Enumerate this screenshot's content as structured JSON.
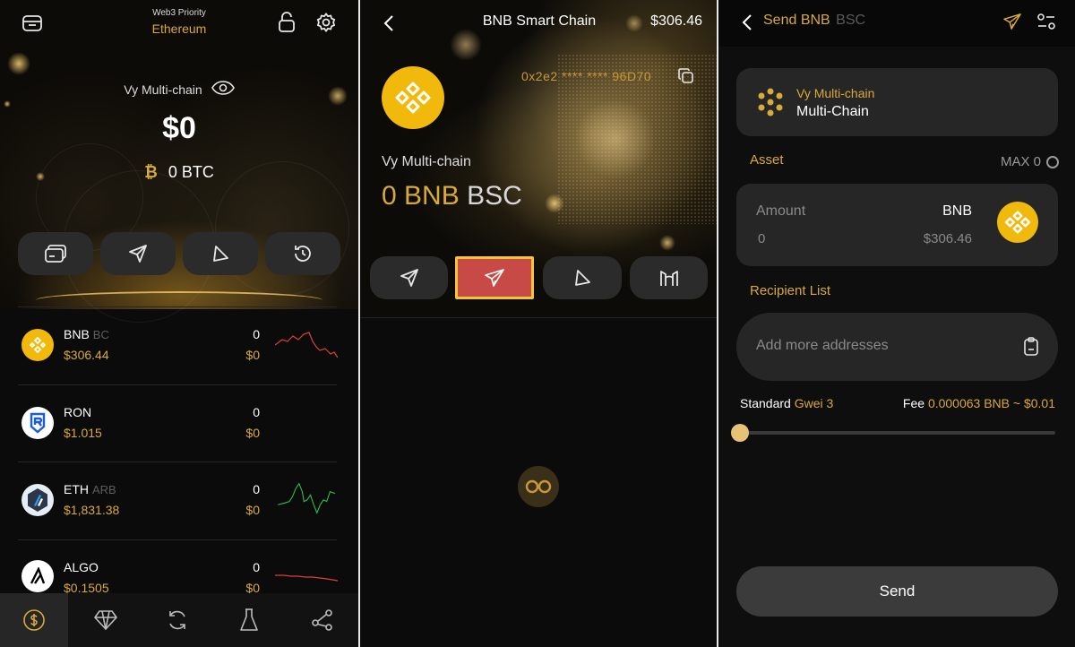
{
  "wallet_home": {
    "network_label": "Web3 Priority",
    "network_name": "Ethereum",
    "wallet_name": "Vy Multi-chain",
    "total_balance": "$0",
    "btc_balance": "0 BTC",
    "assets": [
      {
        "symbol": "BNB",
        "network": "BC",
        "price": "$306.44",
        "amount": "0",
        "value": "$0",
        "trend": "down",
        "icon": "bnb-coin-icon"
      },
      {
        "symbol": "RON",
        "network": "",
        "price": "$1.015",
        "amount": "0",
        "value": "$0",
        "trend": "none",
        "icon": "ronin-coin-icon"
      },
      {
        "symbol": "ETH",
        "network": "ARB",
        "price": "$1,831.38",
        "amount": "0",
        "value": "$0",
        "trend": "up",
        "icon": "arbitrum-coin-icon"
      },
      {
        "symbol": "ALGO",
        "network": "",
        "price": "$0.1505",
        "amount": "0",
        "value": "$0",
        "trend": "down",
        "icon": "algo-coin-icon"
      }
    ],
    "colors": {
      "gold": "#d9a93a",
      "up": "#2fbf4a",
      "down": "#d9423a"
    }
  },
  "chain_detail": {
    "title": "BNB Smart Chain",
    "total": "$306.46",
    "address": "0x2e2 **** **** 96D70",
    "wallet_name": "Vy Multi-chain",
    "balance_amount": "0 BNB",
    "balance_network": "BSC"
  },
  "send_screen": {
    "title": "Send BNB",
    "title_network": "BSC",
    "wallet_name": "Vy Multi-chain",
    "wallet_type": "Multi-Chain",
    "asset_label": "Asset",
    "max_label": "MAX 0",
    "amount_label": "Amount",
    "amount_value": "0",
    "asset_symbol": "BNB",
    "asset_usd": "$306.46",
    "recipient_label": "Recipient List",
    "recipient_placeholder": "Add more addresses",
    "fee_standard": "Standard",
    "fee_gwei": "Gwei 3",
    "fee_label": "Fee",
    "fee_value": "0.000063 BNB ~ $0.01",
    "fee_level": 0,
    "send_label": "Send"
  }
}
